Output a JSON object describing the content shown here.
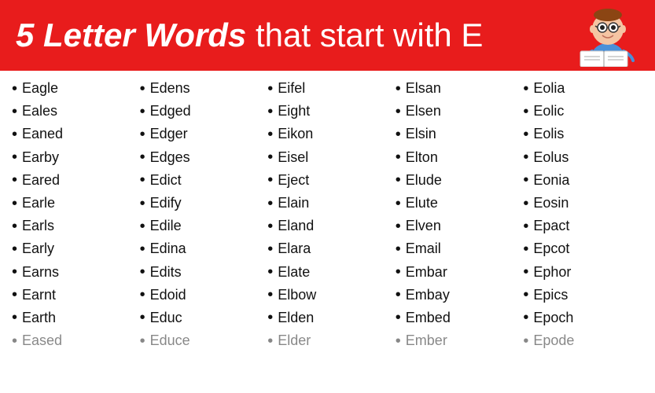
{
  "header": {
    "title_bold": "5 Letter Words",
    "title_normal": " that start with E"
  },
  "columns": [
    {
      "words": [
        "Eagle",
        "Eales",
        "Eaned",
        "Earby",
        "Eared",
        "Earle",
        "Earls",
        "Early",
        "Earns",
        "Earnt",
        "Earth",
        "Eased"
      ]
    },
    {
      "words": [
        "Edens",
        "Edged",
        "Edger",
        "Edges",
        "Edict",
        "Edify",
        "Edile",
        "Edina",
        "Edits",
        "Edoid",
        "Educ",
        "Educe"
      ]
    },
    {
      "words": [
        "Eifel",
        "Eight",
        "Eikon",
        "Eisel",
        "Eject",
        "Elain",
        "Eland",
        "Elara",
        "Elate",
        "Elbow",
        "Elden",
        "Elder"
      ]
    },
    {
      "words": [
        "Elsan",
        "Elsen",
        "Elsin",
        "Elton",
        "Elude",
        "Elute",
        "Elven",
        "Email",
        "Embar",
        "Embay",
        "Embed",
        "Ember"
      ]
    },
    {
      "words": [
        "Eolia",
        "Eolic",
        "Eolis",
        "Eolus",
        "Eonia",
        "Eosin",
        "Epact",
        "Epcot",
        "Ephor",
        "Epics",
        "Epoch",
        "Epode"
      ]
    }
  ]
}
